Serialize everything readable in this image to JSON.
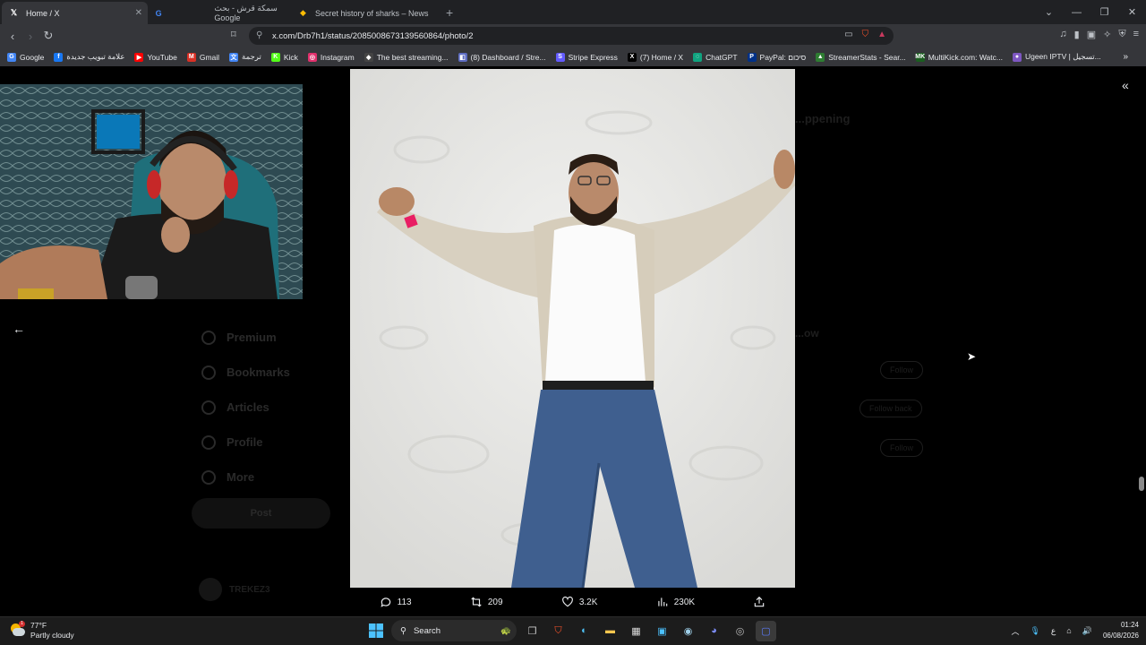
{
  "browser": {
    "tabs": [
      {
        "title": "Home / X",
        "active": true
      },
      {
        "title": "سمكة قرش - بحث Google",
        "active": false
      },
      {
        "title": "Secret history of sharks – News",
        "active": false
      }
    ],
    "url": "x.com/Drb7h1/status/2085008673139560864/photo/2",
    "bookmarks": [
      {
        "label": "Google",
        "icon": "G",
        "color": "#4285f4"
      },
      {
        "label": "علامة تبويب جديدة",
        "icon": "f",
        "color": "#1877f2"
      },
      {
        "label": "YouTube",
        "icon": "▶",
        "color": "#ff0000"
      },
      {
        "label": "Gmail",
        "icon": "M",
        "color": "#d93025"
      },
      {
        "label": "ترجمة",
        "icon": "文",
        "color": "#4285f4"
      },
      {
        "label": "Kick",
        "icon": "K",
        "color": "#53fc18"
      },
      {
        "label": "Instagram",
        "icon": "◎",
        "color": "#e1306c"
      },
      {
        "label": "The best streaming...",
        "icon": "◆",
        "color": "#444"
      },
      {
        "label": "(8) Dashboard / Stre...",
        "icon": "◧",
        "color": "#5c6bc0"
      },
      {
        "label": "Stripe Express",
        "icon": "S",
        "color": "#635bff"
      },
      {
        "label": "(7) Home / X",
        "icon": "X",
        "color": "#000"
      },
      {
        "label": "ChatGPT",
        "icon": "◌",
        "color": "#10a37f"
      },
      {
        "label": "PayPal: סיכום",
        "icon": "P",
        "color": "#003087"
      },
      {
        "label": "StreamerStats - Sear...",
        "icon": "▲",
        "color": "#2e7d32"
      },
      {
        "label": "MultiKick.com: Watc...",
        "icon": "MK",
        "color": "#1b5e20"
      },
      {
        "label": "Ugeen IPTV | تسجيل...",
        "icon": "●",
        "color": "#7e57c2"
      }
    ]
  },
  "x_page": {
    "nav_items": [
      "Premium",
      "Bookmarks",
      "Articles",
      "Profile",
      "More"
    ],
    "post_button": "Post",
    "right_heading": "...ppening",
    "right_follow": [
      "Follow",
      "Follow back",
      "Follow"
    ],
    "right_follow_heading": "...ow",
    "user_name": "TREKEZ3"
  },
  "post_actions": {
    "replies": "113",
    "reposts": "209",
    "likes": "3.2K",
    "views": "230K"
  },
  "taskbar": {
    "weather_temp": "77°F",
    "weather_desc": "Partly cloudy",
    "search_placeholder": "Search",
    "time": "01:24",
    "date": "06/08/2026",
    "language": "ع"
  }
}
